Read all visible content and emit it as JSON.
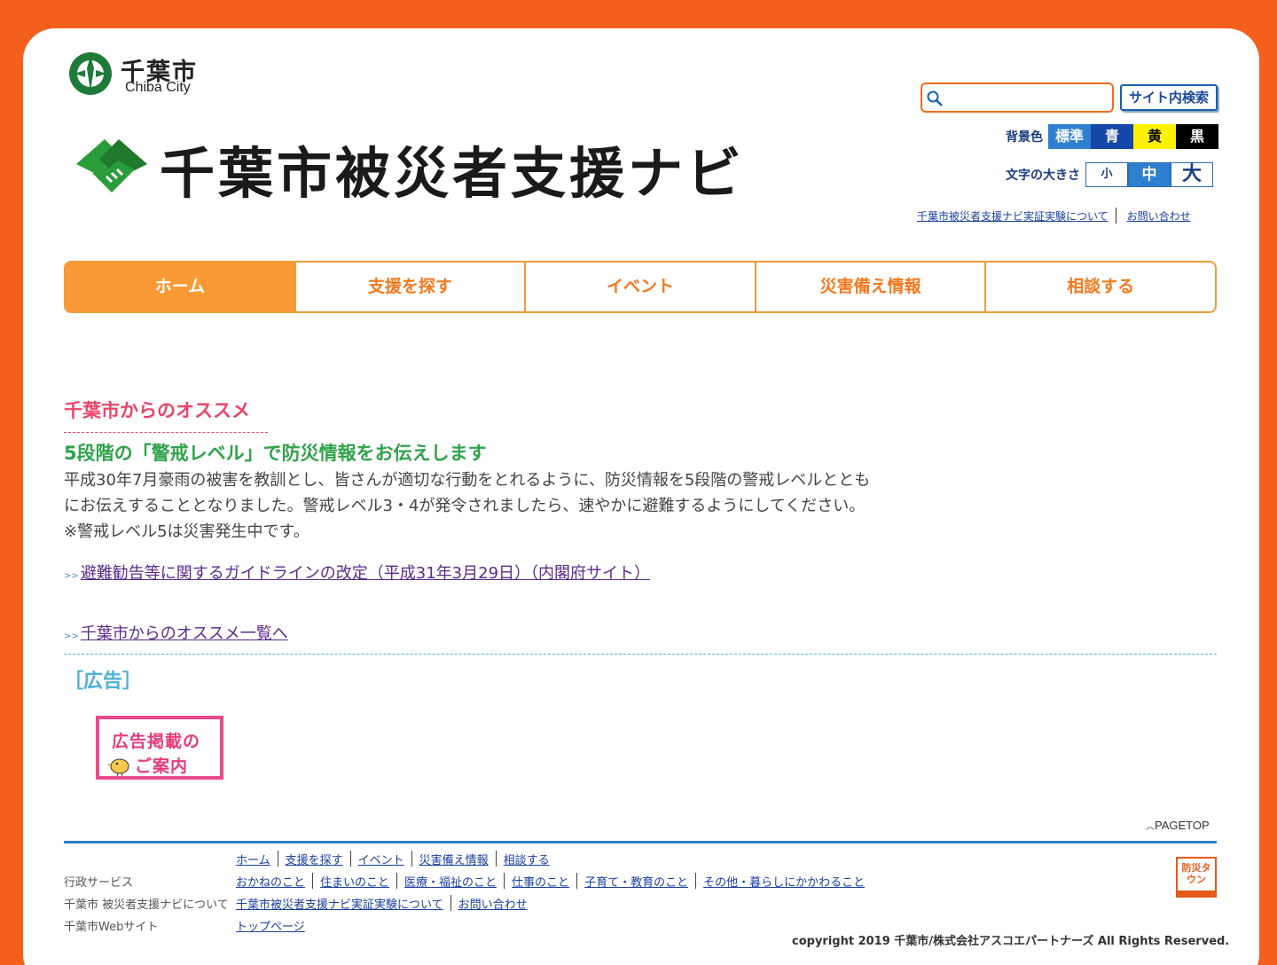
{
  "header": {
    "city_name_ja": "千葉市",
    "city_name_en": "Chiba City",
    "site_title": "千葉市被災者支援ナビ",
    "search": {
      "placeholder": "",
      "button_label": "サイト内検索"
    },
    "bg_color": {
      "label": "背景色",
      "options": [
        {
          "label": "標準",
          "bg": "#2f7fd0",
          "fg": "#ffffff"
        },
        {
          "label": "青",
          "bg": "#1646a8",
          "fg": "#ffffff"
        },
        {
          "label": "黄",
          "bg": "#fff200",
          "fg": "#000000"
        },
        {
          "label": "黒",
          "bg": "#000000",
          "fg": "#ffffff"
        }
      ]
    },
    "font_size": {
      "label": "文字の大きさ",
      "options": [
        {
          "label": "小",
          "bg": "#ffffff",
          "fg": "#1a3d80"
        },
        {
          "label": "中",
          "bg": "#2f7fd0",
          "fg": "#ffffff"
        },
        {
          "label": "大",
          "bg": "#ffffff",
          "fg": "#1a3d80"
        }
      ]
    },
    "links": [
      "千葉市被災者支援ナビ実証実験について",
      "お問い合わせ"
    ]
  },
  "nav": {
    "items": [
      "ホーム",
      "支援を探す",
      "イベント",
      "災害備え情報",
      "相談する"
    ]
  },
  "main": {
    "recommend_heading": "千葉市からのオススメ",
    "news_title": "5段階の「警戒レベル」で防災情報をお伝えします",
    "news_body": "平成30年7月豪雨の被害を教訓とし、皆さんが適切な行動をとれるように、防災情報を5段階の警戒レベルとともにお伝えすることとなりました。警戒レベル3・4が発令されましたら、速やかに避難するようにしてください。 ※警戒レベル5は災害発生中です。",
    "guideline_link": "避難勧告等に関するガイドラインの改定（平成31年3月29日）（内閣府サイト）",
    "recommend_list_link": "千葉市からのオススメ一覧へ",
    "arrow": ">>",
    "ad_heading": "［広告］",
    "ad_banner": {
      "line1": "広告掲載の",
      "line2": "ご案内"
    }
  },
  "footer": {
    "pagetop": "PAGETOP",
    "rows": [
      {
        "label": "",
        "links": [
          "ホーム",
          "支援を探す",
          "イベント",
          "災害備え情報",
          "相談する"
        ]
      },
      {
        "label": "行政サービス",
        "links": [
          "おかねのこと",
          "住まいのこと",
          "医療・福祉のこと",
          "仕事のこと",
          "子育て・教育のこと",
          "その他・暮らしにかかわること"
        ]
      },
      {
        "label": "千葉市 被災者支援ナビについて",
        "links": [
          "千葉市被災者支援ナビ実証実験について",
          "お問い合わせ"
        ]
      },
      {
        "label": "千葉市Webサイト",
        "links": [
          "トップページ"
        ]
      }
    ],
    "bousai_badge": "防災タウン",
    "copyright": "copyright 2019 千葉市/株式会社アスコエパートナーズ All Rights Reserved."
  }
}
